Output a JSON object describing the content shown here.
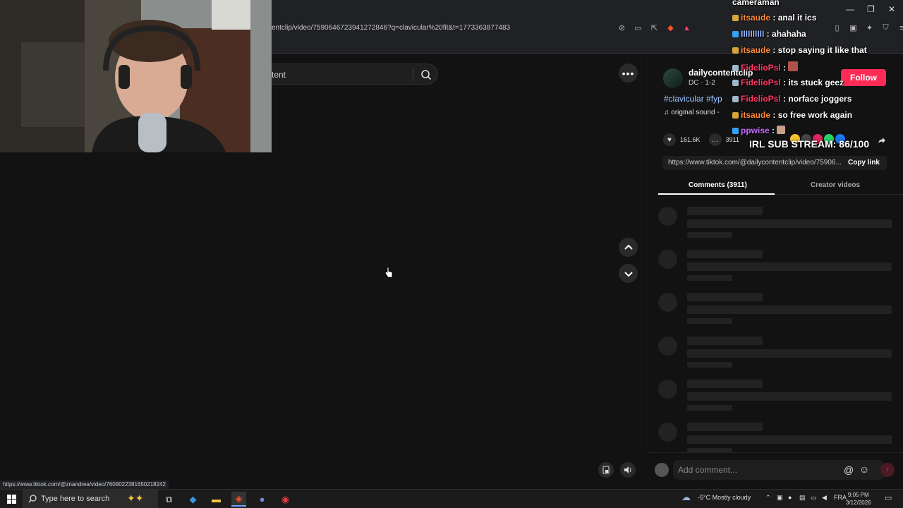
{
  "browser": {
    "url": "entclip/video/7590646723941272846?q=clavicular%20fit&t=1773363877483",
    "status_url": "https://www.tiktok.com/@znandrea/video/7609022381650218242"
  },
  "page": {
    "search_placeholder": "tent"
  },
  "post": {
    "creator_name": "dailycontentclip",
    "creator_sub": "DC · 1-2",
    "follow_label": "Follow",
    "hashtags": "#clavicular #fyp",
    "sound": "original sound -",
    "likes": "161.6K",
    "comments": "3911",
    "link": "https://www.tiktok.com/@dailycontentclip/video/75906...",
    "copy_label": "Copy link",
    "tabs": [
      {
        "label": "Comments (3911)"
      },
      {
        "label": "Creator videos"
      }
    ],
    "comment_placeholder": "Add comment..."
  },
  "chat": {
    "header": "cameraman",
    "lines": [
      {
        "user": "itsaude",
        "message": "anal it ics"
      },
      {
        "user": "IIIIIIIIII",
        "message": "ahahaha"
      },
      {
        "user": "itsaude",
        "message": "stop saying it like that"
      },
      {
        "user": "FidelioPsl",
        "message": ""
      },
      {
        "user": "FidelioPsl",
        "message": "its stuck geez"
      },
      {
        "user": "FidelioPsl",
        "message": "norface joggers"
      },
      {
        "user": "itsaude",
        "message": "so free work again"
      },
      {
        "user": "ppwise",
        "message": ""
      }
    ],
    "sub_stream": "IRL SUB STREAM: 86/100"
  },
  "taskbar": {
    "search_placeholder": "Type here to search",
    "weather": "-5°C  Mostly cloudy",
    "lang": "FRA",
    "time": "9:05 PM",
    "date": "3/12/2026"
  },
  "colors": {
    "accent": "#fe2c55",
    "background": "#121212"
  }
}
